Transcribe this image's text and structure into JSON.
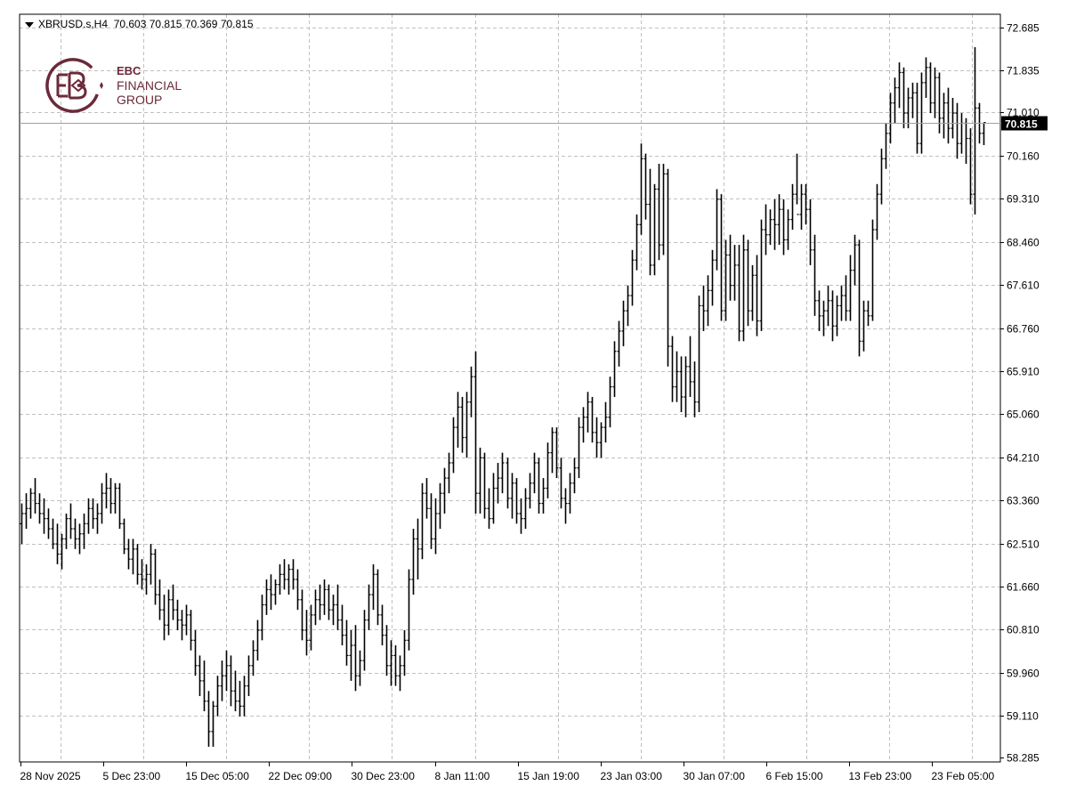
{
  "header": {
    "symbol_info": "XBRUSD.s,H4",
    "ohlc": "70.603 70.815 70.369 70.815"
  },
  "logo": {
    "brand": "EBC",
    "line1": "FINANCIAL",
    "line2": "GROUP"
  },
  "colors": {
    "background": "#ffffff",
    "bars": "#000000",
    "grid": "#c0c0c0",
    "price_line": "#a0a0a0",
    "price_tag_bg": "#000000",
    "price_tag_text": "#ffffff",
    "logo": "#6b2a3a"
  },
  "chart_data": {
    "type": "ohlc",
    "symbol": "XBRUSD.s",
    "timeframe": "H4",
    "y_ticks": [
      "72.685",
      "71.835",
      "71.010",
      "70.160",
      "69.310",
      "68.460",
      "67.610",
      "66.760",
      "65.910",
      "65.060",
      "64.210",
      "63.360",
      "62.510",
      "61.660",
      "60.810",
      "59.960",
      "59.110",
      "58.285"
    ],
    "x_ticks": [
      "28 Nov 2025",
      "5 Dec 23:00",
      "15 Dec 05:00",
      "22 Dec 09:00",
      "30 Dec 23:00",
      "8 Jan 11:00",
      "15 Jan 19:00",
      "23 Jan 03:00",
      "30 Jan 07:00",
      "6 Feb 15:00",
      "13 Feb 23:00",
      "23 Feb 05:00"
    ],
    "ylim": [
      58.2,
      72.95
    ],
    "current_price": "70.815",
    "grid": true,
    "bars": [
      [
        62.9,
        63.3,
        62.5,
        63.1
      ],
      [
        63.1,
        63.5,
        62.8,
        63.2
      ],
      [
        63.2,
        63.6,
        63.0,
        63.5
      ],
      [
        63.5,
        63.8,
        63.1,
        63.3
      ],
      [
        63.3,
        63.5,
        62.9,
        63.1
      ],
      [
        63.1,
        63.4,
        62.7,
        63.0
      ],
      [
        63.0,
        63.2,
        62.6,
        62.8
      ],
      [
        62.8,
        63.0,
        62.4,
        62.5
      ],
      [
        62.5,
        62.9,
        62.1,
        62.3
      ],
      [
        62.3,
        62.7,
        62.0,
        62.6
      ],
      [
        62.6,
        63.1,
        62.4,
        63.0
      ],
      [
        63.0,
        63.3,
        62.6,
        62.8
      ],
      [
        62.8,
        63.0,
        62.4,
        62.6
      ],
      [
        62.6,
        62.9,
        62.3,
        62.7
      ],
      [
        62.7,
        63.1,
        62.4,
        62.9
      ],
      [
        62.9,
        63.4,
        62.7,
        63.2
      ],
      [
        63.2,
        63.4,
        62.8,
        63.0
      ],
      [
        63.0,
        63.3,
        62.7,
        63.1
      ],
      [
        63.1,
        63.7,
        62.9,
        63.5
      ],
      [
        63.5,
        63.9,
        63.2,
        63.6
      ],
      [
        63.6,
        63.8,
        63.1,
        63.3
      ],
      [
        63.3,
        63.7,
        63.1,
        63.6
      ],
      [
        63.6,
        63.7,
        62.8,
        62.9
      ],
      [
        62.9,
        63.0,
        62.3,
        62.4
      ],
      [
        62.4,
        62.6,
        62.0,
        62.2
      ],
      [
        62.2,
        62.6,
        61.9,
        62.4
      ],
      [
        62.4,
        62.5,
        61.7,
        61.9
      ],
      [
        61.9,
        62.2,
        61.6,
        61.8
      ],
      [
        61.8,
        62.1,
        61.5,
        61.9
      ],
      [
        61.9,
        62.5,
        61.7,
        62.3
      ],
      [
        62.3,
        62.4,
        61.3,
        61.5
      ],
      [
        61.5,
        61.8,
        61.0,
        61.2
      ],
      [
        61.2,
        61.5,
        60.6,
        60.9
      ],
      [
        60.9,
        61.6,
        60.7,
        61.4
      ],
      [
        61.4,
        61.7,
        61.0,
        61.2
      ],
      [
        61.2,
        61.4,
        60.8,
        61.0
      ],
      [
        61.0,
        61.2,
        60.6,
        60.9
      ],
      [
        60.9,
        61.3,
        60.7,
        61.1
      ],
      [
        61.1,
        61.2,
        60.4,
        60.6
      ],
      [
        60.6,
        60.8,
        59.9,
        60.1
      ],
      [
        60.1,
        60.3,
        59.5,
        59.8
      ],
      [
        59.8,
        60.2,
        59.2,
        59.4
      ],
      [
        59.4,
        59.6,
        58.5,
        58.8
      ],
      [
        58.8,
        59.4,
        58.5,
        59.3
      ],
      [
        59.3,
        59.9,
        59.1,
        59.7
      ],
      [
        59.7,
        60.2,
        59.4,
        59.9
      ],
      [
        59.9,
        60.4,
        59.6,
        60.1
      ],
      [
        60.1,
        60.3,
        59.3,
        59.6
      ],
      [
        59.6,
        60.0,
        59.2,
        59.4
      ],
      [
        59.4,
        59.8,
        59.1,
        59.3
      ],
      [
        59.3,
        59.9,
        59.1,
        59.7
      ],
      [
        59.7,
        60.3,
        59.5,
        60.1
      ],
      [
        60.1,
        60.6,
        59.9,
        60.4
      ],
      [
        60.4,
        61.0,
        60.2,
        60.8
      ],
      [
        60.8,
        61.5,
        60.6,
        61.3
      ],
      [
        61.3,
        61.8,
        61.1,
        61.6
      ],
      [
        61.6,
        61.9,
        61.2,
        61.5
      ],
      [
        61.5,
        61.8,
        61.3,
        61.7
      ],
      [
        61.7,
        62.1,
        61.5,
        61.9
      ],
      [
        61.9,
        62.2,
        61.6,
        61.8
      ],
      [
        61.8,
        62.1,
        61.5,
        62.0
      ],
      [
        62.0,
        62.2,
        61.6,
        61.8
      ],
      [
        61.8,
        62.0,
        61.2,
        61.4
      ],
      [
        61.4,
        61.6,
        60.6,
        60.8
      ],
      [
        60.8,
        61.2,
        60.3,
        60.6
      ],
      [
        60.6,
        61.3,
        60.4,
        61.1
      ],
      [
        61.1,
        61.6,
        60.9,
        61.4
      ],
      [
        61.4,
        61.7,
        61.0,
        61.3
      ],
      [
        61.3,
        61.8,
        61.1,
        61.6
      ],
      [
        61.6,
        61.7,
        61.0,
        61.2
      ],
      [
        61.2,
        61.5,
        60.9,
        61.3
      ],
      [
        61.3,
        61.7,
        60.8,
        61.0
      ],
      [
        61.0,
        61.3,
        60.5,
        60.7
      ],
      [
        60.7,
        61.0,
        60.1,
        60.3
      ],
      [
        60.3,
        60.8,
        59.8,
        60.5
      ],
      [
        60.5,
        60.9,
        59.6,
        59.9
      ],
      [
        59.9,
        60.4,
        59.7,
        60.2
      ],
      [
        60.2,
        61.2,
        60.0,
        61.0
      ],
      [
        61.0,
        61.7,
        60.8,
        61.5
      ],
      [
        61.5,
        62.1,
        61.2,
        61.9
      ],
      [
        61.9,
        62.0,
        60.9,
        61.1
      ],
      [
        61.1,
        61.3,
        60.5,
        60.7
      ],
      [
        60.7,
        60.9,
        59.9,
        60.1
      ],
      [
        60.1,
        60.6,
        59.7,
        60.3
      ],
      [
        60.3,
        60.5,
        59.7,
        59.9
      ],
      [
        59.9,
        60.3,
        59.6,
        60.1
      ],
      [
        60.1,
        60.8,
        59.9,
        60.6
      ],
      [
        60.6,
        62.0,
        60.4,
        61.8
      ],
      [
        61.8,
        62.8,
        61.5,
        62.6
      ],
      [
        62.6,
        63.0,
        61.8,
        62.4
      ],
      [
        62.4,
        63.7,
        62.2,
        63.5
      ],
      [
        63.5,
        63.8,
        63.0,
        63.2
      ],
      [
        63.2,
        63.5,
        62.4,
        62.6
      ],
      [
        62.6,
        63.4,
        62.3,
        63.1
      ],
      [
        63.1,
        63.7,
        62.8,
        63.5
      ],
      [
        63.5,
        64.0,
        63.1,
        63.8
      ],
      [
        63.8,
        64.3,
        63.5,
        64.1
      ],
      [
        64.1,
        65.0,
        63.9,
        64.8
      ],
      [
        64.8,
        65.5,
        64.4,
        65.2
      ],
      [
        65.2,
        65.4,
        64.3,
        64.6
      ],
      [
        64.6,
        65.5,
        64.2,
        65.3
      ],
      [
        65.3,
        66.0,
        65.0,
        65.8
      ],
      [
        65.8,
        66.3,
        63.1,
        63.5
      ],
      [
        63.5,
        64.4,
        63.1,
        64.2
      ],
      [
        64.2,
        64.3,
        63.0,
        63.2
      ],
      [
        63.2,
        63.6,
        62.8,
        63.0
      ],
      [
        63.0,
        63.9,
        62.9,
        63.6
      ],
      [
        63.6,
        64.1,
        63.3,
        63.8
      ],
      [
        63.8,
        64.3,
        63.5,
        64.1
      ],
      [
        64.1,
        64.2,
        63.2,
        63.4
      ],
      [
        63.4,
        63.9,
        63.0,
        63.7
      ],
      [
        63.7,
        63.8,
        62.9,
        63.1
      ],
      [
        63.1,
        63.4,
        62.7,
        63.0
      ],
      [
        63.0,
        63.6,
        62.8,
        63.4
      ],
      [
        63.4,
        63.9,
        63.2,
        63.7
      ],
      [
        63.7,
        64.3,
        63.5,
        64.1
      ],
      [
        64.1,
        64.2,
        63.1,
        63.3
      ],
      [
        63.3,
        63.8,
        63.1,
        63.6
      ],
      [
        63.6,
        64.5,
        63.4,
        64.3
      ],
      [
        64.3,
        64.8,
        63.9,
        64.7
      ],
      [
        64.7,
        64.8,
        63.8,
        64.0
      ],
      [
        64.0,
        64.2,
        63.2,
        63.4
      ],
      [
        63.4,
        63.6,
        62.9,
        63.3
      ],
      [
        63.3,
        63.9,
        63.1,
        63.7
      ],
      [
        63.7,
        64.2,
        63.5,
        64.0
      ],
      [
        64.0,
        65.0,
        63.8,
        64.8
      ],
      [
        64.8,
        65.2,
        64.5,
        65.0
      ],
      [
        65.0,
        65.5,
        64.7,
        65.3
      ],
      [
        65.3,
        65.4,
        64.5,
        64.7
      ],
      [
        64.7,
        65.0,
        64.2,
        64.5
      ],
      [
        64.5,
        64.9,
        64.2,
        64.8
      ],
      [
        64.8,
        65.3,
        64.5,
        65.0
      ],
      [
        65.0,
        65.8,
        64.8,
        65.6
      ],
      [
        65.6,
        66.5,
        65.4,
        66.3
      ],
      [
        66.3,
        66.9,
        66.0,
        66.7
      ],
      [
        66.7,
        67.3,
        66.4,
        67.1
      ],
      [
        67.1,
        67.6,
        66.8,
        67.4
      ],
      [
        67.4,
        68.3,
        67.2,
        68.1
      ],
      [
        68.1,
        69.0,
        67.9,
        68.8
      ],
      [
        68.8,
        70.4,
        68.6,
        70.1
      ],
      [
        70.1,
        70.2,
        68.9,
        69.2
      ],
      [
        69.2,
        69.9,
        67.8,
        68.0
      ],
      [
        68.0,
        69.6,
        67.8,
        69.5
      ],
      [
        69.5,
        70.0,
        68.1,
        68.4
      ],
      [
        68.4,
        70.0,
        68.2,
        69.8
      ],
      [
        69.8,
        69.9,
        66.0,
        66.4
      ],
      [
        66.4,
        66.6,
        65.3,
        65.6
      ],
      [
        65.6,
        66.3,
        65.3,
        65.9
      ],
      [
        65.9,
        66.2,
        65.1,
        65.4
      ],
      [
        65.4,
        66.2,
        65.0,
        66.0
      ],
      [
        66.0,
        66.6,
        65.4,
        65.7
      ],
      [
        65.7,
        66.1,
        65.0,
        65.3
      ],
      [
        65.3,
        67.4,
        65.1,
        67.2
      ],
      [
        67.2,
        67.6,
        66.7,
        67.1
      ],
      [
        67.1,
        67.8,
        66.8,
        67.5
      ],
      [
        67.5,
        68.3,
        67.2,
        68.1
      ],
      [
        68.1,
        69.5,
        67.9,
        69.3
      ],
      [
        69.3,
        69.4,
        66.9,
        67.1
      ],
      [
        67.1,
        68.5,
        66.9,
        68.2
      ],
      [
        68.2,
        68.6,
        67.3,
        67.6
      ],
      [
        67.6,
        68.4,
        67.3,
        68.0
      ],
      [
        68.0,
        68.4,
        66.5,
        66.7
      ],
      [
        66.7,
        68.6,
        66.5,
        68.3
      ],
      [
        68.3,
        68.5,
        66.8,
        67.1
      ],
      [
        67.1,
        68.0,
        66.9,
        67.8
      ],
      [
        67.8,
        68.2,
        66.6,
        66.9
      ],
      [
        66.9,
        68.9,
        66.7,
        68.7
      ],
      [
        68.7,
        69.2,
        68.2,
        68.6
      ],
      [
        68.6,
        69.1,
        68.4,
        68.9
      ],
      [
        68.9,
        69.3,
        68.3,
        68.8
      ],
      [
        68.8,
        69.4,
        68.4,
        69.1
      ],
      [
        69.1,
        69.3,
        68.2,
        68.5
      ],
      [
        68.5,
        69.1,
        68.3,
        68.9
      ],
      [
        68.9,
        69.6,
        68.7,
        69.4
      ],
      [
        69.4,
        70.2,
        69.2,
        69.0
      ],
      [
        69.0,
        69.6,
        68.7,
        69.4
      ],
      [
        69.4,
        69.6,
        68.8,
        69.1
      ],
      [
        69.1,
        69.3,
        68.0,
        68.3
      ],
      [
        68.3,
        68.6,
        67.0,
        67.3
      ],
      [
        67.3,
        67.5,
        66.7,
        67.0
      ],
      [
        67.0,
        67.3,
        66.6,
        67.1
      ],
      [
        67.1,
        67.6,
        66.8,
        67.3
      ],
      [
        67.3,
        67.5,
        66.5,
        66.8
      ],
      [
        66.8,
        67.4,
        66.6,
        67.2
      ],
      [
        67.2,
        67.6,
        66.9,
        67.4
      ],
      [
        67.4,
        67.8,
        66.9,
        67.1
      ],
      [
        67.1,
        68.2,
        66.9,
        67.9
      ],
      [
        67.9,
        68.6,
        67.6,
        68.4
      ],
      [
        68.4,
        68.5,
        66.2,
        66.5
      ],
      [
        66.5,
        67.3,
        66.3,
        67.1
      ],
      [
        67.1,
        67.3,
        66.8,
        67.0
      ],
      [
        67.0,
        68.9,
        66.9,
        68.7
      ],
      [
        68.7,
        69.6,
        68.5,
        69.4
      ],
      [
        69.4,
        70.3,
        69.2,
        70.1
      ],
      [
        70.1,
        70.8,
        69.9,
        70.6
      ],
      [
        70.6,
        71.4,
        70.4,
        71.2
      ],
      [
        71.2,
        71.7,
        70.8,
        71.5
      ],
      [
        71.5,
        72.0,
        71.1,
        71.8
      ],
      [
        71.8,
        71.9,
        70.7,
        71.0
      ],
      [
        71.0,
        71.5,
        70.7,
        71.3
      ],
      [
        71.3,
        71.6,
        70.9,
        71.4
      ],
      [
        71.4,
        71.6,
        70.2,
        70.4
      ],
      [
        70.4,
        71.8,
        70.2,
        71.6
      ],
      [
        71.6,
        72.1,
        71.3,
        71.9
      ],
      [
        71.9,
        72.0,
        71.0,
        71.2
      ],
      [
        71.2,
        71.9,
        70.9,
        71.7
      ],
      [
        71.7,
        71.8,
        70.6,
        70.9
      ],
      [
        70.9,
        71.4,
        70.5,
        71.2
      ],
      [
        71.2,
        71.5,
        70.4,
        70.7
      ],
      [
        70.7,
        71.3,
        70.5,
        71.0
      ],
      [
        71.0,
        71.2,
        70.1,
        70.4
      ],
      [
        70.4,
        71.0,
        70.2,
        70.8
      ],
      [
        70.8,
        70.9,
        70.0,
        70.5
      ],
      [
        70.5,
        70.7,
        69.2,
        69.4
      ],
      [
        69.4,
        72.3,
        69.0,
        71.1
      ],
      [
        71.1,
        71.2,
        70.4,
        70.6
      ],
      [
        70.603,
        70.815,
        70.369,
        70.815
      ]
    ]
  }
}
